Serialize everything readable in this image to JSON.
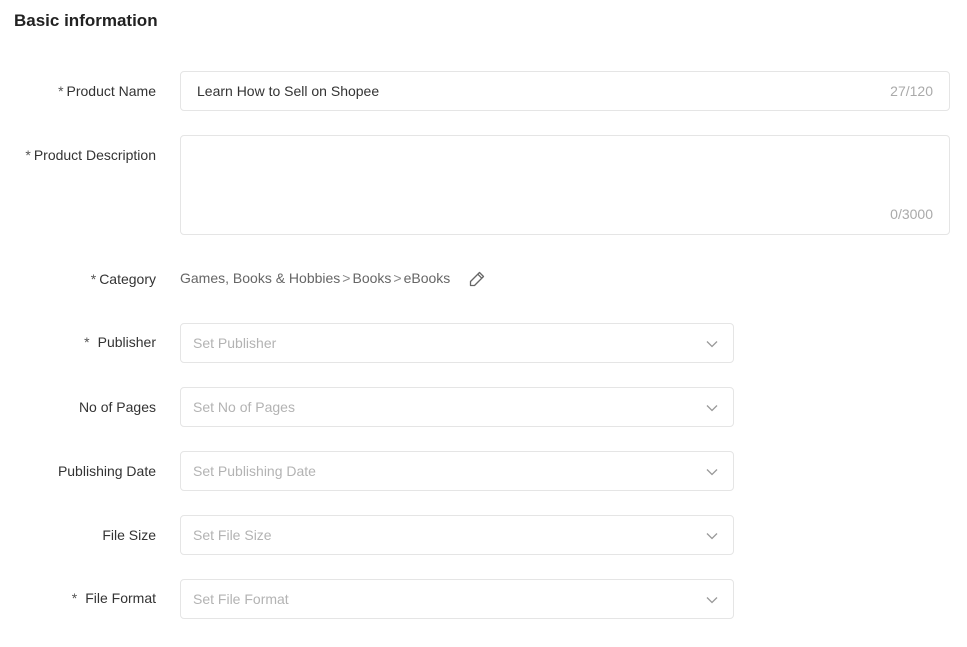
{
  "section": {
    "title": "Basic information"
  },
  "required_mark": "*",
  "product_name": {
    "label": "Product Name",
    "value": "Learn How to Sell on Shopee",
    "counter": "27/120"
  },
  "product_description": {
    "label": "Product Description",
    "value": "",
    "counter": "0/3000"
  },
  "category": {
    "label": "Category",
    "path": [
      "Games, Books & Hobbies",
      "Books",
      "eBooks"
    ],
    "separator": ">",
    "edit_icon": "pencil-icon"
  },
  "publisher": {
    "label": "Publisher",
    "placeholder": "Set Publisher"
  },
  "no_of_pages": {
    "label": "No of Pages",
    "placeholder": "Set No of Pages"
  },
  "publishing_date": {
    "label": "Publishing Date",
    "placeholder": "Set Publishing Date"
  },
  "file_size": {
    "label": "File Size",
    "placeholder": "Set File Size"
  },
  "file_format": {
    "label": "File Format",
    "placeholder": "Set File Format"
  },
  "icons": {
    "dropdown": "chevron-down-icon"
  }
}
